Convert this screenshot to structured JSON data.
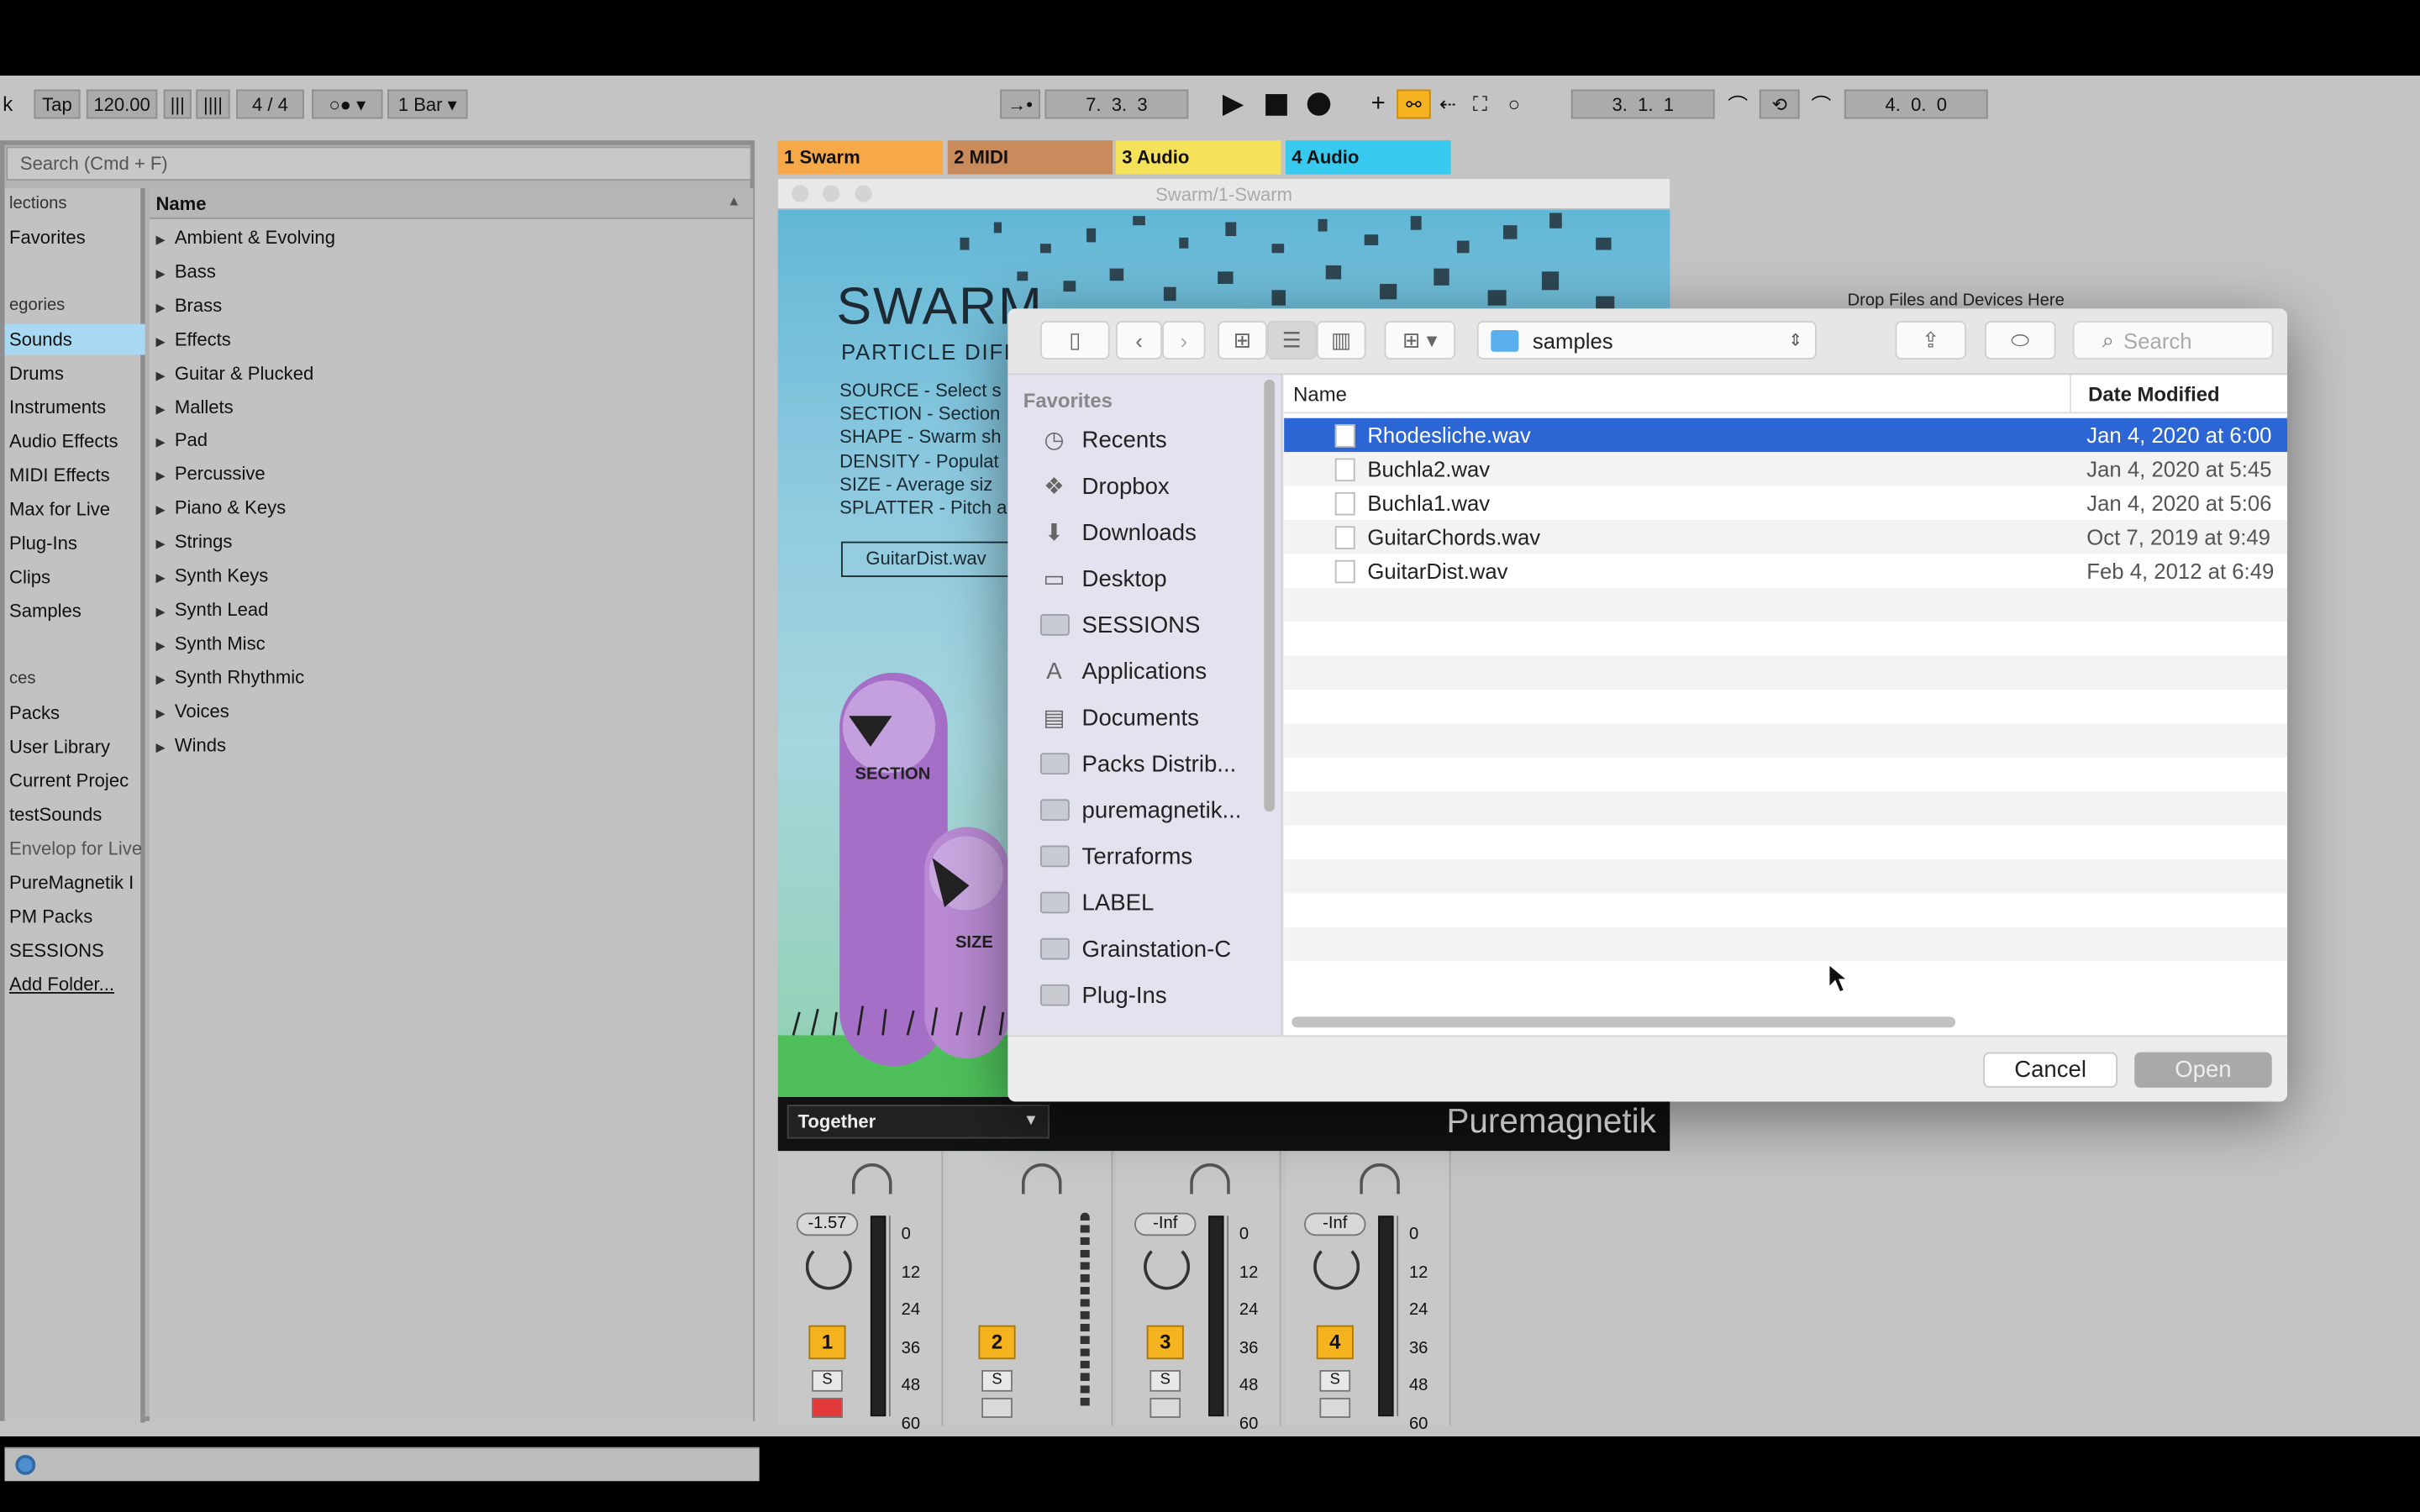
{
  "toolbar": {
    "tap": "Tap",
    "tempo": "120.00",
    "time_sig": "4 / 4",
    "quantize": "1 Bar",
    "arrangement_position": "7.  3.  3",
    "loop_start": "3.  1.  1",
    "loop_length": "4.  0.  0",
    "left_partial": "k"
  },
  "browser": {
    "search_placeholder": "Search (Cmd + F)",
    "categories": [
      {
        "label": "lections",
        "type": "hdr"
      },
      {
        "label": "Favorites",
        "type": "item"
      },
      {
        "label": "egories",
        "type": "hdr"
      },
      {
        "label": "Sounds",
        "type": "sel"
      },
      {
        "label": "Drums",
        "type": "item"
      },
      {
        "label": "Instruments",
        "type": "item"
      },
      {
        "label": "Audio Effects",
        "type": "item"
      },
      {
        "label": "MIDI Effects",
        "type": "item"
      },
      {
        "label": "Max for Live",
        "type": "item"
      },
      {
        "label": "Plug-Ins",
        "type": "item"
      },
      {
        "label": "Clips",
        "type": "item"
      },
      {
        "label": "Samples",
        "type": "item"
      },
      {
        "label": "ces",
        "type": "hdr"
      },
      {
        "label": "Packs",
        "type": "item"
      },
      {
        "label": "User Library",
        "type": "item"
      },
      {
        "label": "Current Projec",
        "type": "item"
      },
      {
        "label": "testSounds",
        "type": "item"
      },
      {
        "label": "Envelop for Live",
        "type": "dim"
      },
      {
        "label": "PureMagnetik I",
        "type": "item"
      },
      {
        "label": "PM Packs",
        "type": "item"
      },
      {
        "label": "SESSIONS",
        "type": "item"
      },
      {
        "label": "Add Folder...",
        "type": "link"
      }
    ],
    "name_header": "Name",
    "sounds": [
      "Ambient & Evolving",
      "Bass",
      "Brass",
      "Effects",
      "Guitar & Plucked",
      "Mallets",
      "Pad",
      "Percussive",
      "Piano & Keys",
      "Strings",
      "Synth Keys",
      "Synth Lead",
      "Synth Misc",
      "Synth Rhythmic",
      "Voices",
      "Winds"
    ]
  },
  "tracks": [
    {
      "name": "1 Swarm",
      "color": "#f7a94a"
    },
    {
      "name": "2 MIDI",
      "color": "#c98a5c"
    },
    {
      "name": "3 Audio",
      "color": "#f5e15a"
    },
    {
      "name": "4 Audio",
      "color": "#38c9ee"
    }
  ],
  "session": {
    "drop_text": "Drop Files and Devices Here"
  },
  "swarm": {
    "window_title": "Swarm/1-Swarm",
    "title": "SWARM",
    "subtitle": "PARTICLE DIFF",
    "lines": [
      "SOURCE - Select s",
      "SECTION - Section",
      "SHAPE - Swarm sh",
      "DENSITY - Populat",
      "SIZE - Average siz",
      "SPLATTER - Pitch a"
    ],
    "file_button": "GuitarDist.wav",
    "section_label": "SECTION",
    "size_label": "SIZE",
    "mode": "Together",
    "brand": "Puremagnetik"
  },
  "mixer": [
    {
      "volume": "-1.57",
      "number": "1",
      "solo": "S",
      "rec": "armed"
    },
    {
      "volume": "",
      "number": "2",
      "solo": "S",
      "rec": "midi"
    },
    {
      "volume": "-Inf",
      "number": "3",
      "solo": "S",
      "rec": "off"
    },
    {
      "volume": "-Inf",
      "number": "4",
      "solo": "S",
      "rec": "off"
    }
  ],
  "meter_scale": [
    "0",
    "12",
    "24",
    "36",
    "48",
    "60"
  ],
  "dialog": {
    "location": "samples",
    "search_placeholder": "Search",
    "favorites_header": "Favorites",
    "favorites": [
      {
        "label": "Recents",
        "icon": "clock-icon"
      },
      {
        "label": "Dropbox",
        "icon": "dropbox-icon"
      },
      {
        "label": "Downloads",
        "icon": "download-icon"
      },
      {
        "label": "Desktop",
        "icon": "desktop-icon"
      },
      {
        "label": "SESSIONS",
        "icon": "folder-icon"
      },
      {
        "label": "Applications",
        "icon": "applications-icon"
      },
      {
        "label": "Documents",
        "icon": "document-icon"
      },
      {
        "label": "Packs Distrib...",
        "icon": "folder-icon"
      },
      {
        "label": "puremagnetik...",
        "icon": "folder-icon"
      },
      {
        "label": "Terraforms",
        "icon": "folder-icon"
      },
      {
        "label": "LABEL",
        "icon": "folder-icon"
      },
      {
        "label": "Grainstation-C",
        "icon": "folder-icon"
      },
      {
        "label": "Plug-Ins",
        "icon": "folder-icon"
      }
    ],
    "col_name": "Name",
    "col_date": "Date Modified",
    "files": [
      {
        "name": "Rhodesliche.wav",
        "date": "Jan 4, 2020 at 6:00"
      },
      {
        "name": "Buchla2.wav",
        "date": "Jan 4, 2020 at 5:45"
      },
      {
        "name": "Buchla1.wav",
        "date": "Jan 4, 2020 at 5:06"
      },
      {
        "name": "GuitarChords.wav",
        "date": "Oct 7, 2019 at 9:49"
      },
      {
        "name": "GuitarDist.wav",
        "date": "Feb 4, 2012 at 6:49"
      }
    ],
    "selected_file": "Rhodesliche.wav",
    "cancel": "Cancel",
    "open": "Open"
  }
}
